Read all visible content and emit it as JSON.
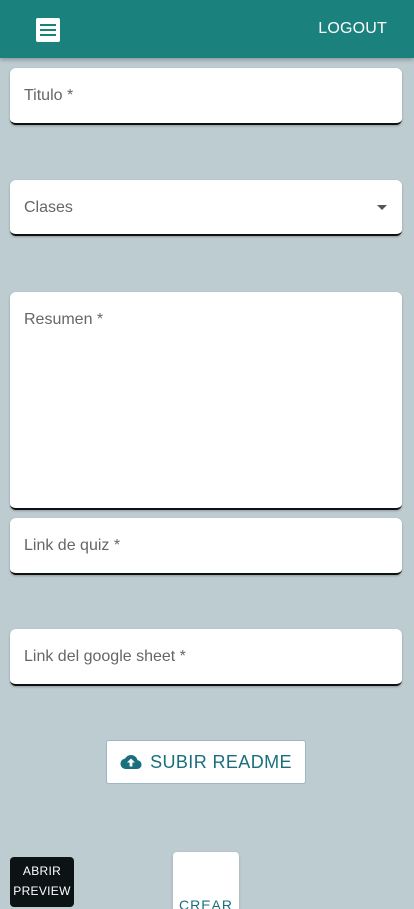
{
  "appbar": {
    "menu_icon": "hamburger-menu-icon",
    "logout_label": "LOGOUT",
    "color": "#1A817D"
  },
  "form": {
    "titulo_label": "Titulo *",
    "clases_label": "Clases",
    "resumen_label": "Resumen *",
    "quiz_label": "Link de quiz *",
    "sheet_label": "Link del google sheet *"
  },
  "actions": {
    "upload_label": "SUBIR README",
    "upload_icon": "cloud-upload-icon",
    "preview_line1": "ABRIR",
    "preview_line2": "PREVIEW",
    "crear_label": "CREAR"
  },
  "colors": {
    "background": "#BDCCD0",
    "accent": "#1A817D",
    "button_text": "#1A6F7D"
  }
}
